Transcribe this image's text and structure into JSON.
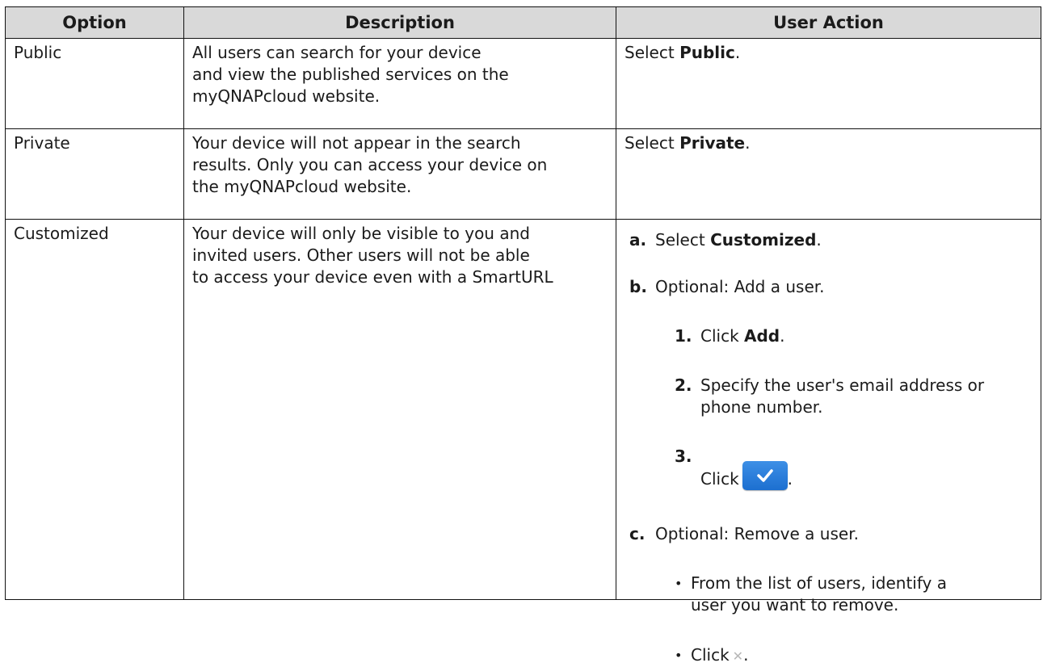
{
  "headers": {
    "option": "Option",
    "description": "Description",
    "user_action": "User Action"
  },
  "rows": {
    "public": {
      "option": "Public",
      "description": "All users can search for your device\nand view the published services on the\nmyQNAPcloud website.",
      "action_prefix": "Select ",
      "action_keyword": "Public",
      "action_suffix": "."
    },
    "private": {
      "option": "Private",
      "description": "Your device will not appear in the search\nresults. Only you can access your device on\nthe myQNAPcloud website.",
      "action_prefix": "Select ",
      "action_keyword": "Private",
      "action_suffix": "."
    },
    "customized": {
      "option": "Customized",
      "description": "Your device will only be visible to you and\ninvited users. Other users will not be able\nto access your device even with a SmartURL",
      "steps": {
        "a": {
          "label": "a.",
          "prefix": "Select ",
          "keyword": "Customized",
          "suffix": "."
        },
        "b": {
          "label": "b.",
          "text": "Optional: Add a user.",
          "sub1": {
            "num": "1.",
            "prefix": "Click ",
            "keyword": "Add",
            "suffix": "."
          },
          "sub2": {
            "num": "2.",
            "text_line1": "Specify the user's email address or",
            "text_line2": "phone number."
          },
          "sub3": {
            "num": "3.",
            "prefix": "Click",
            "suffix": "."
          }
        },
        "c": {
          "label": "c.",
          "text": "Optional: Remove a user.",
          "bullet1_line1": "From the list of users, identify a",
          "bullet1_line2": "user you want to remove.",
          "bullet2_prefix": "Click",
          "bullet2_suffix": "."
        }
      }
    }
  },
  "icons": {
    "confirm": "check-icon",
    "remove": "close-icon"
  },
  "colors": {
    "header_bg": "#d9d9d9",
    "confirm_button": "#2a7ddb",
    "remove_icon": "#b7b7b7"
  }
}
